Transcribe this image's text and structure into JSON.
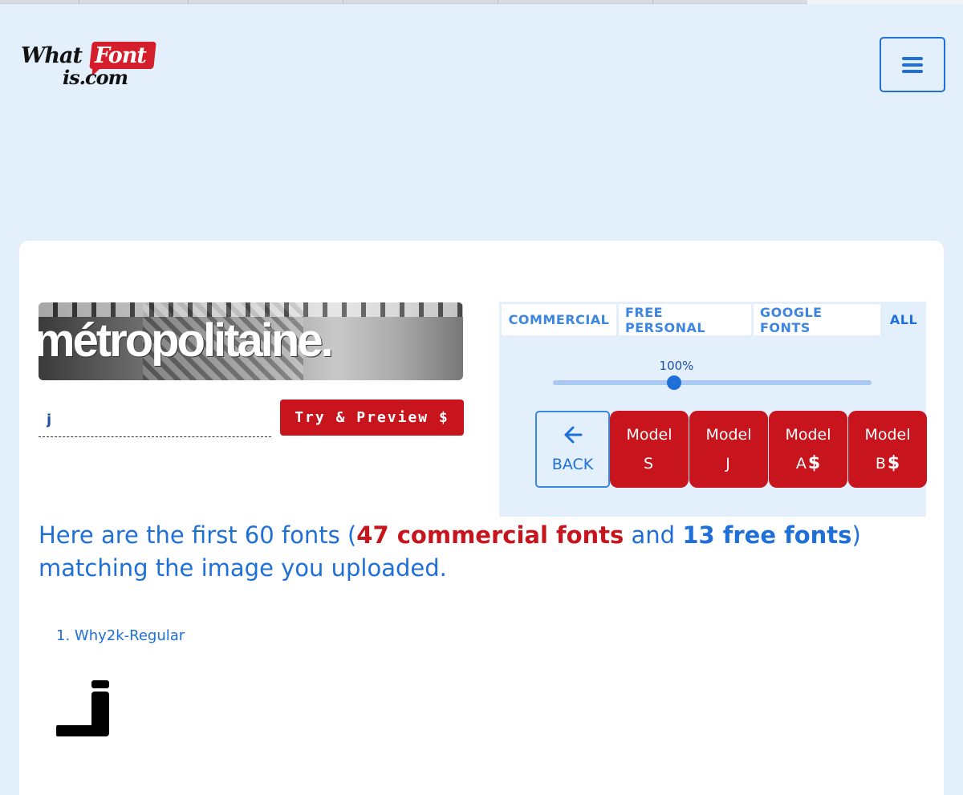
{
  "header": {
    "logo": {
      "what": "What",
      "font": "Font",
      "is_com": "is.com"
    },
    "menu_icon": "hamburger-icon"
  },
  "upload": {
    "image_text": "métropolitaine.",
    "character_input_value": "j",
    "try_preview_label": "Try & Preview $"
  },
  "filters": {
    "tabs": [
      {
        "label": "COMMERCIAL",
        "active": false
      },
      {
        "label": "FREE PERSONAL",
        "active": false
      },
      {
        "label": "GOOGLE FONTS",
        "active": false
      },
      {
        "label": "ALL",
        "active": true
      }
    ],
    "zoom_label": "100%",
    "zoom_fraction": 0.38
  },
  "models": {
    "back_label": "BACK",
    "back_icon": "arrow-left-icon",
    "buttons": [
      {
        "line1": "Model",
        "line2": "S",
        "paid": ""
      },
      {
        "line1": "Model",
        "line2": "J",
        "paid": ""
      },
      {
        "line1": "Model",
        "line2": "A",
        "paid": "$"
      },
      {
        "line1": "Model",
        "line2": "B",
        "paid": "$"
      }
    ]
  },
  "results": {
    "prefix": "Here are the first 60 fonts (",
    "commercial_count": "47",
    "commercial_text": " commercial fonts",
    "and_text": " and ",
    "free_count": "13",
    "free_text": " free fonts",
    "suffix": ") matching the image you uploaded.",
    "items": [
      {
        "name": "1. Why2k-Regular",
        "preview_char": "j"
      }
    ]
  },
  "colors": {
    "accent_blue": "#1f6fd8",
    "accent_red": "#c8141d",
    "page_bg": "#e3effb"
  }
}
